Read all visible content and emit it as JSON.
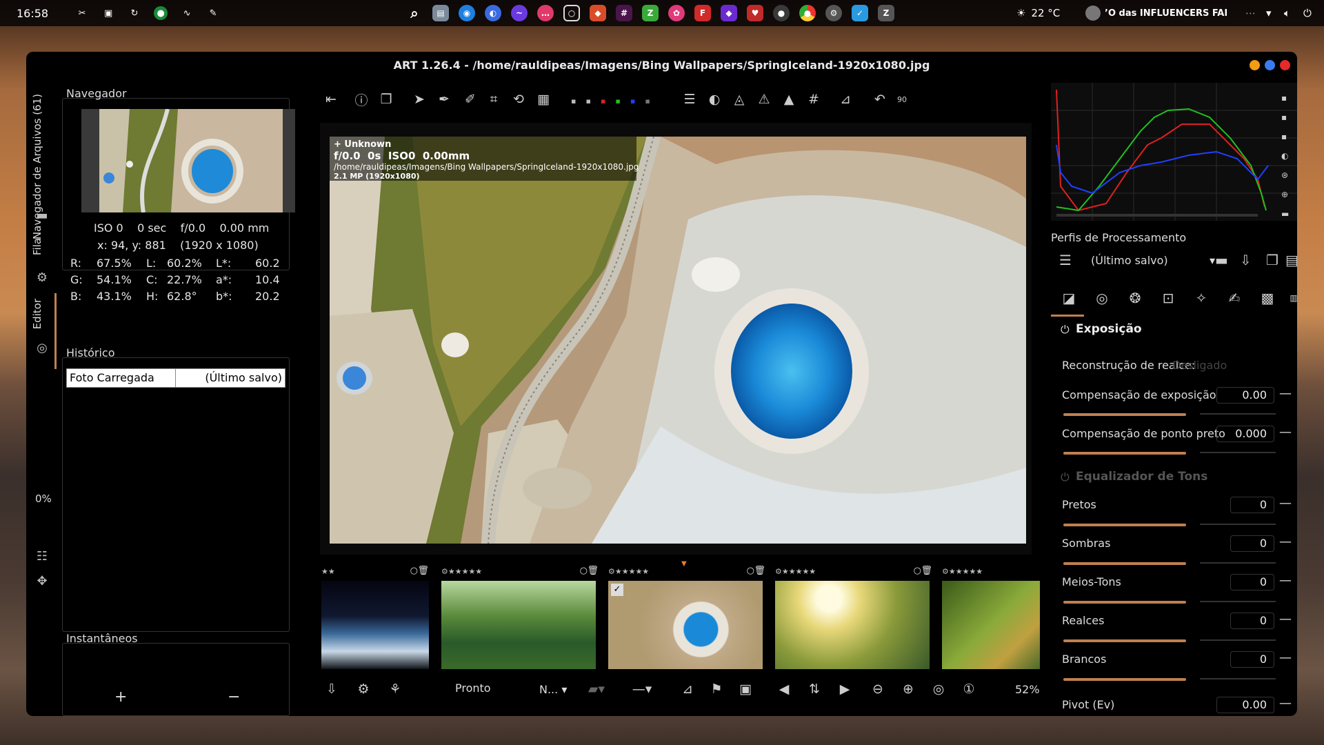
{
  "topbar": {
    "time": "16:58",
    "weather": "22 °C",
    "media": "’O das INFLUENCERS FAI"
  },
  "window": {
    "title": "ART 1.26.4 - /home/rauldipeas/Imagens/Bing Wallpapers/SpringIceland-1920x1080.jpg"
  },
  "vtabs": {
    "browser": "Navegador de Arquivos (61)",
    "queue": "Fila",
    "editor": "Editor",
    "progress": "0%"
  },
  "navigator": {
    "title": "Navegador",
    "exif": "ISO 0    0 sec    f/0.0    0.00 mm",
    "coords": "x: 94, y: 881    (1920 x 1080)",
    "r_label": "R:",
    "r": "67.5%",
    "l_label": "L:",
    "l": "60.2%",
    "lstar_label": "L*:",
    "lstar": "60.2",
    "g_label": "G:",
    "g": "54.1%",
    "c_label": "C:",
    "c": "22.7%",
    "astar_label": "a*:",
    "astar": "10.4",
    "b_label": "B:",
    "b": "43.1%",
    "h_label": "H:",
    "h": "62.8°",
    "bstar_label": "b*:",
    "bstar": "20.2"
  },
  "history": {
    "title": "Histórico",
    "event": "Foto Carregada",
    "profile": "(Último salvo)"
  },
  "snapshots": {
    "title": "Instantâneos",
    "add": "+",
    "remove": "−"
  },
  "overlay": {
    "line1": "+ Unknown",
    "line2": "f/0.0  0s  ISO0  0.00mm",
    "line3": "/home/rauldipeas/Imagens/Bing Wallpapers/SpringIceland-1920x1080.jpg",
    "line4": "2.1 MP (1920x1080)"
  },
  "status": {
    "ready": "Pronto",
    "mode": "N...",
    "zoom": "52%"
  },
  "profiles": {
    "title": "Perfis de Processamento",
    "selected": "(Último salvo)"
  },
  "exposure": {
    "title": "Exposição",
    "highlight_label": "Reconstrução de realce:",
    "highlight_value": "Desligado",
    "exp_label": "Compensação de exposição",
    "exp_value": "0.00",
    "black_label": "Compensação de ponto preto",
    "black_value": "0.000"
  },
  "tone_eq": {
    "title": "Equalizador de Tons",
    "items": [
      {
        "label": "Pretos",
        "value": "0"
      },
      {
        "label": "Sombras",
        "value": "0"
      },
      {
        "label": "Meios-Tons",
        "value": "0"
      },
      {
        "label": "Realces",
        "value": "0"
      },
      {
        "label": "Brancos",
        "value": "0"
      }
    ],
    "pivot_label": "Pivot (Ev)",
    "pivot_value": "0.00"
  },
  "histogram_colors": {
    "red": "#e02020",
    "green": "#20c020",
    "blue": "#2040ff"
  }
}
